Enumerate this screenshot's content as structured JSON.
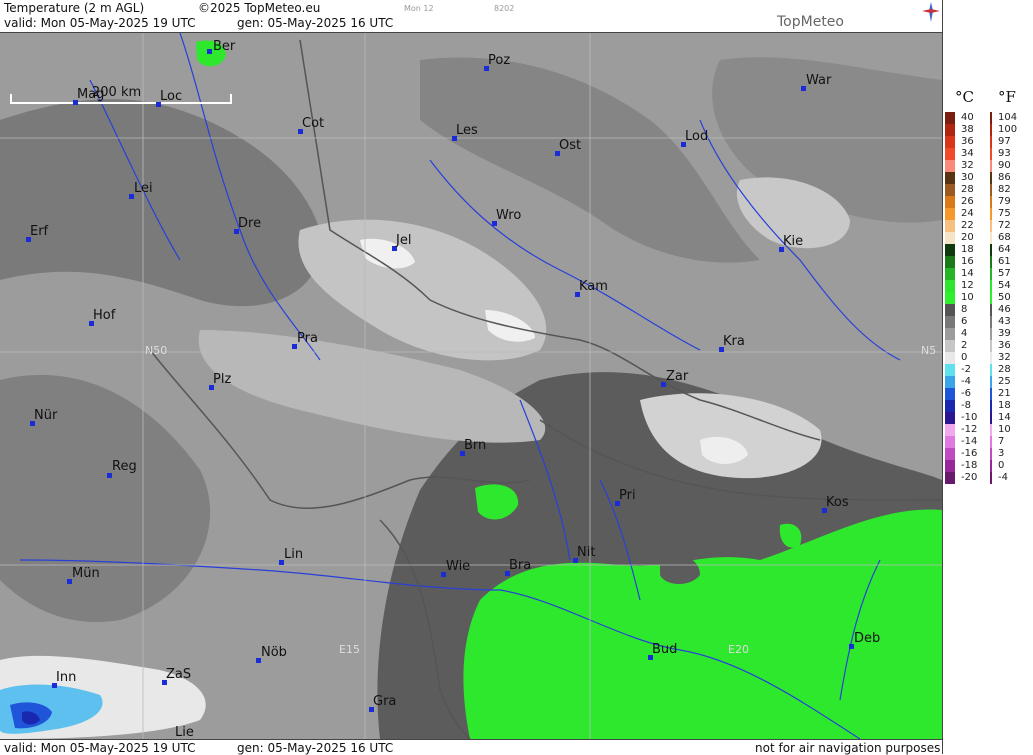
{
  "header": {
    "title": "Temperature (2 m AGL)",
    "copyright": "©2025 TopMeteo.eu",
    "model_run": "Mon 12",
    "code": "8202",
    "valid": "valid:  Mon  05-May-2025  19 UTC",
    "generated": "gen: 05-May-2025 16 UTC",
    "logo": "TopMeteo"
  },
  "footer": {
    "valid": "valid:  Mon  05-May-2025  19 UTC",
    "generated": "gen: 05-May-2025 16 UTC",
    "disclaimer": "not for air navigation purposes"
  },
  "scale_bar": {
    "label": "200 km"
  },
  "grid_labels": {
    "n50_left": "N50",
    "n50_right": "N5",
    "e15": "E15",
    "e20": "E20"
  },
  "cities": [
    {
      "name": "Ber"
    },
    {
      "name": "Poz"
    },
    {
      "name": "War"
    },
    {
      "name": "Mag"
    },
    {
      "name": "Loc"
    },
    {
      "name": "Cot"
    },
    {
      "name": "Les"
    },
    {
      "name": "Ost"
    },
    {
      "name": "Lod"
    },
    {
      "name": "Lei"
    },
    {
      "name": "Dre"
    },
    {
      "name": "Wro"
    },
    {
      "name": "Erf"
    },
    {
      "name": "Jel"
    },
    {
      "name": "Kie"
    },
    {
      "name": "Kam"
    },
    {
      "name": "Hof"
    },
    {
      "name": "Pra"
    },
    {
      "name": "Kra"
    },
    {
      "name": "Zar"
    },
    {
      "name": "Plz"
    },
    {
      "name": "Nür"
    },
    {
      "name": "Brn"
    },
    {
      "name": "Reg"
    },
    {
      "name": "Pri"
    },
    {
      "name": "Kos"
    },
    {
      "name": "Lin"
    },
    {
      "name": "Nit"
    },
    {
      "name": "Mün"
    },
    {
      "name": "Wie"
    },
    {
      "name": "Bra"
    },
    {
      "name": "Deb"
    },
    {
      "name": "Bud"
    },
    {
      "name": "Nöb"
    },
    {
      "name": "ZaS"
    },
    {
      "name": "Inn"
    },
    {
      "name": "Gra"
    },
    {
      "name": "Lie"
    }
  ],
  "legend": {
    "unit_c": "°C",
    "unit_f": "°F",
    "rows": [
      {
        "c": "40",
        "f": "104",
        "color": "#7a1e10"
      },
      {
        "c": "38",
        "f": "100",
        "color": "#b1250f"
      },
      {
        "c": "36",
        "f": "97",
        "color": "#d8351a"
      },
      {
        "c": "34",
        "f": "93",
        "color": "#f04a2a"
      },
      {
        "c": "32",
        "f": "90",
        "color": "#f98a7a"
      },
      {
        "c": "30",
        "f": "86",
        "color": "#5a3310"
      },
      {
        "c": "28",
        "f": "82",
        "color": "#9a5a22"
      },
      {
        "c": "26",
        "f": "79",
        "color": "#d97a1a"
      },
      {
        "c": "24",
        "f": "75",
        "color": "#f59a2a"
      },
      {
        "c": "22",
        "f": "72",
        "color": "#f8c080"
      },
      {
        "c": "20",
        "f": "68",
        "color": "#f6e4c6"
      },
      {
        "c": "18",
        "f": "64",
        "color": "#0e3a0e"
      },
      {
        "c": "16",
        "f": "61",
        "color": "#1a7a1a"
      },
      {
        "c": "14",
        "f": "57",
        "color": "#28b428"
      },
      {
        "c": "12",
        "f": "54",
        "color": "#2ee62e"
      },
      {
        "c": "10",
        "f": "50",
        "color": "#2ef02e"
      },
      {
        "c": "8",
        "f": "46",
        "color": "#555555"
      },
      {
        "c": "6",
        "f": "43",
        "color": "#787878"
      },
      {
        "c": "4",
        "f": "39",
        "color": "#9c9c9c"
      },
      {
        "c": "2",
        "f": "36",
        "color": "#c6c6c6"
      },
      {
        "c": "0",
        "f": "32",
        "color": "#e8e8e8"
      },
      {
        "c": "-2",
        "f": "28",
        "color": "#5ee0ee"
      },
      {
        "c": "-4",
        "f": "25",
        "color": "#3aa6e8"
      },
      {
        "c": "-6",
        "f": "21",
        "color": "#1f55d8"
      },
      {
        "c": "-8",
        "f": "18",
        "color": "#1a28b0"
      },
      {
        "c": "-10",
        "f": "14",
        "color": "#2a1690"
      },
      {
        "c": "-12",
        "f": "10",
        "color": "#f0a8f0"
      },
      {
        "c": "-14",
        "f": "7",
        "color": "#e07ae0"
      },
      {
        "c": "-16",
        "f": "3",
        "color": "#c04ac0"
      },
      {
        "c": "-18",
        "f": "0",
        "color": "#96289a"
      },
      {
        "c": "-20",
        "f": "-4",
        "color": "#6a1a6e"
      }
    ]
  }
}
